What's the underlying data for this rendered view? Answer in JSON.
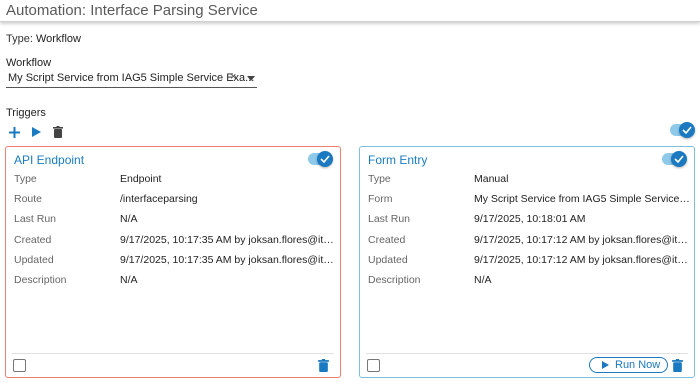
{
  "header": {
    "title": "Automation: Interface Parsing Service"
  },
  "type_line": {
    "label": "Type:",
    "value": "Workflow"
  },
  "workflow": {
    "label": "Workflow",
    "selected": "My Script Service from IAG5 Simple Service Exa...",
    "clear_glyph": "×"
  },
  "triggers": {
    "label": "Triggers",
    "tools": [
      "add-icon",
      "play-icon",
      "trash-icon"
    ],
    "master_toggle": {
      "on": true
    }
  },
  "cards": [
    {
      "title": "API Endpoint",
      "enabled": true,
      "fields": [
        {
          "key": "Type",
          "value": "Endpoint"
        },
        {
          "key": "Route",
          "value": "/interfaceparsing"
        },
        {
          "key": "Last Run",
          "value": "N/A"
        },
        {
          "key": "Created",
          "value": "9/17/2025, 10:17:35 AM by joksan.flores@iten..."
        },
        {
          "key": "Updated",
          "value": "9/17/2025, 10:17:35 AM by joksan.flores@iten..."
        },
        {
          "key": "Description",
          "value": "N/A"
        }
      ]
    },
    {
      "title": "Form Entry",
      "enabled": true,
      "fields": [
        {
          "key": "Type",
          "value": "Manual"
        },
        {
          "key": "Form",
          "value": "My Script Service from IAG5 Simple Service E..."
        },
        {
          "key": "Last Run",
          "value": "9/17/2025, 10:18:01 AM"
        },
        {
          "key": "Created",
          "value": "9/17/2025, 10:17:12 AM by joksan.flores@iten..."
        },
        {
          "key": "Updated",
          "value": "9/17/2025, 10:17:12 AM by joksan.flores@iten..."
        },
        {
          "key": "Description",
          "value": "N/A"
        }
      ],
      "run_button": "Run Now"
    }
  ],
  "colors": {
    "accent": "#1a79c1",
    "endpoint_border": "#f0806f",
    "form_border": "#7cc0de",
    "toggle_track": "#8ec9ea"
  }
}
